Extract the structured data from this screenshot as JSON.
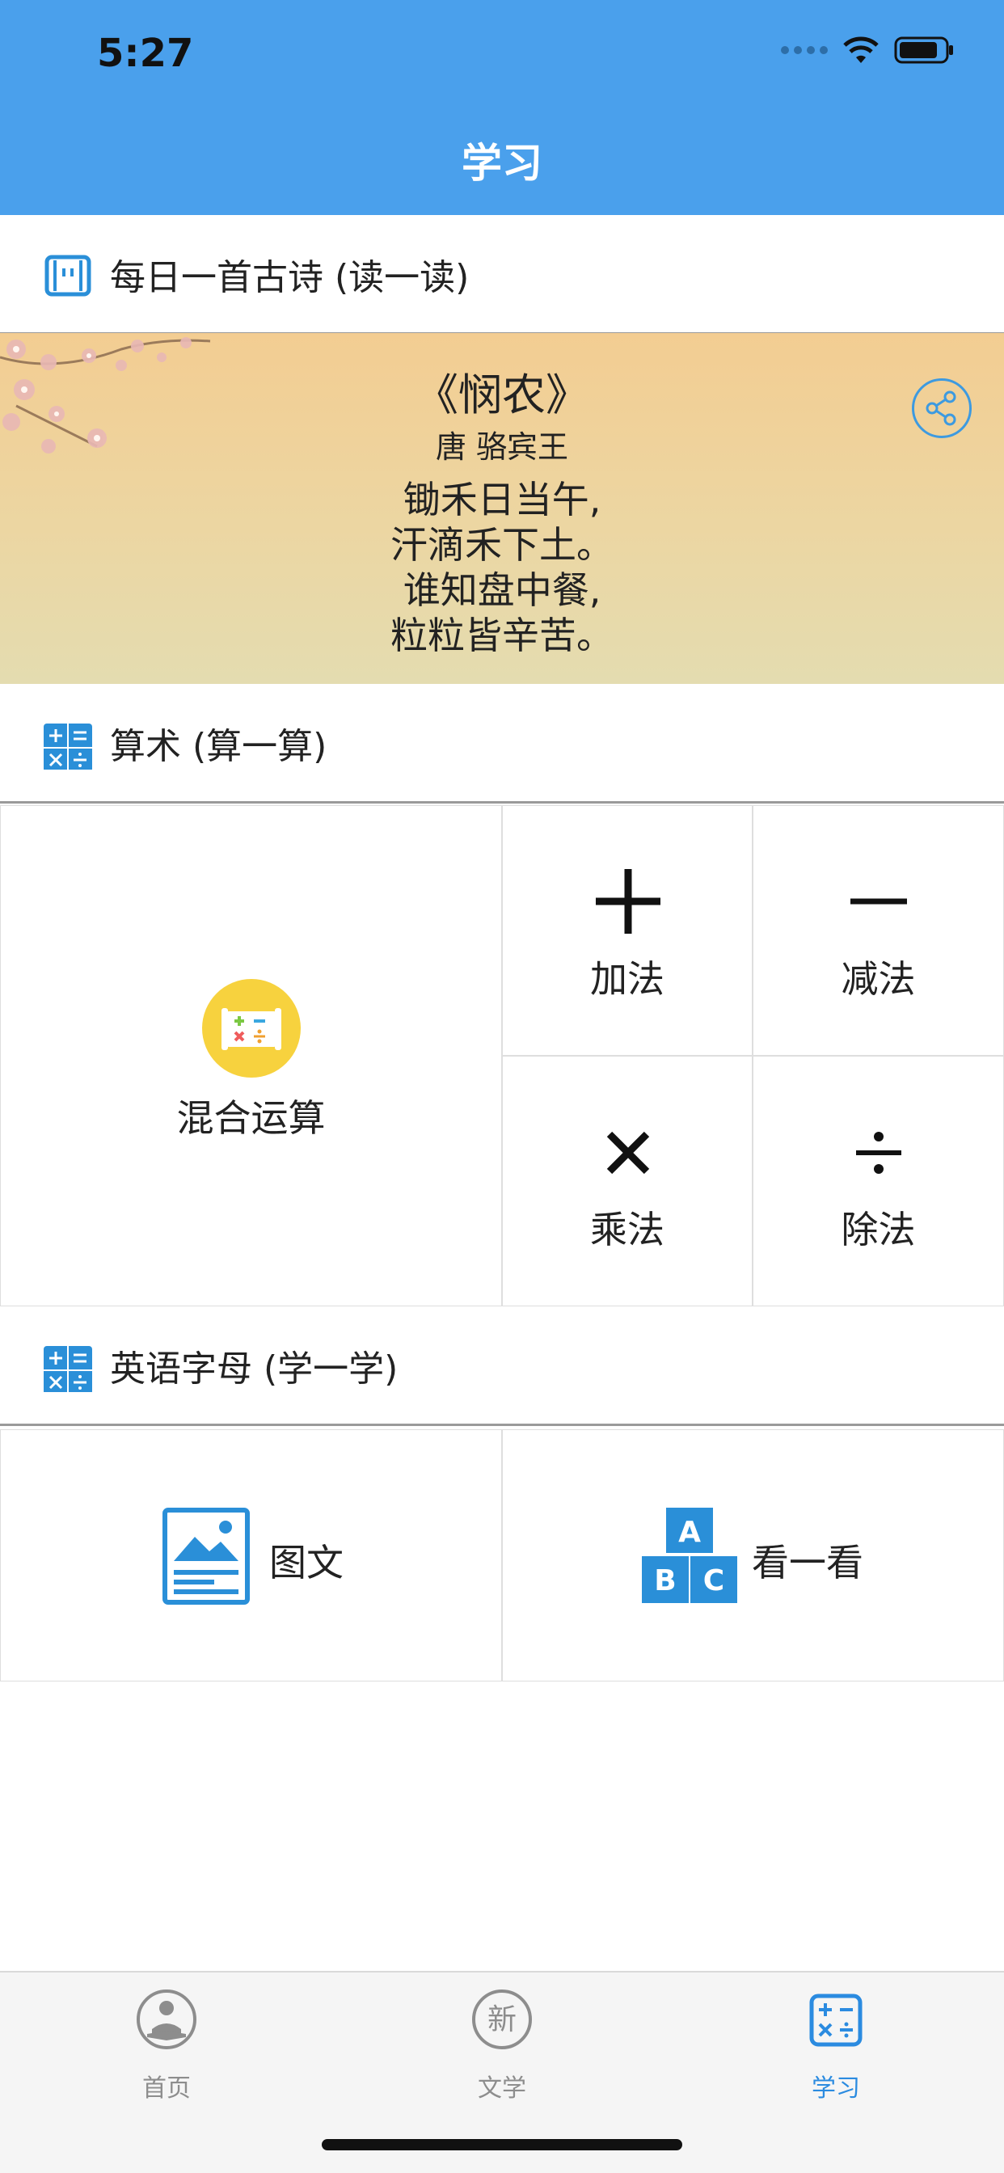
{
  "status_bar": {
    "time": "5:27"
  },
  "header": {
    "title": "学习"
  },
  "sections": {
    "poem_header": "每日一首古诗 (读一读)",
    "arith_header": "算术 (算一算)",
    "english_header": "英语字母 (学一学)"
  },
  "poem": {
    "title": "《悯农》",
    "author": "唐 骆宾王",
    "lines": [
      "锄禾日当午,",
      "汗滴禾下土。",
      "谁知盘中餐,",
      "粒粒皆辛苦。"
    ]
  },
  "arithmetic": {
    "mixed": "混合运算",
    "add": "加法",
    "subtract": "减法",
    "multiply": "乘法",
    "divide": "除法"
  },
  "english": {
    "pictures": "图文",
    "look": "看一看"
  },
  "tabbar": {
    "home": "首页",
    "literature": "文学",
    "study": "学习",
    "literature_icon_char": "新"
  },
  "colors": {
    "header_bg": "#4aa0ec",
    "accent_blue": "#2b8be0",
    "tab_inactive": "#8d8d8d",
    "mixed_icon_yellow": "#f7d23e"
  },
  "icons": {
    "poem_header": "scroll-icon",
    "arith_header": "calculator-icon",
    "english_header": "calculator-icon",
    "share": "share-icon",
    "pictures": "image-document-icon",
    "look": "abc-blocks-icon",
    "home_tab": "reader-icon",
    "literature_tab": "new-badge-icon",
    "study_tab": "calculator-icon"
  }
}
